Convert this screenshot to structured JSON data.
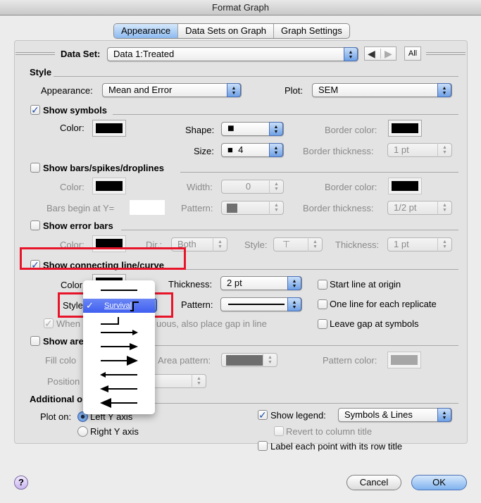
{
  "window": {
    "title": "Format Graph"
  },
  "tabs": [
    {
      "label": "Appearance",
      "active": true
    },
    {
      "label": "Data Sets on Graph",
      "active": false
    },
    {
      "label": "Graph Settings",
      "active": false
    }
  ],
  "dataset": {
    "label": "Data Set:",
    "value": "Data 1:Treated",
    "all_label": "All",
    "prev_icon": "arrow-left-icon",
    "next_icon": "arrow-right-icon"
  },
  "style": {
    "heading": "Style",
    "appearance_label": "Appearance:",
    "appearance_value": "Mean and Error",
    "plot_label": "Plot:",
    "plot_value": "SEM"
  },
  "symbols": {
    "heading": "Show symbols",
    "checked": true,
    "color_label": "Color:",
    "color": "#000000",
    "shape_label": "Shape:",
    "shape_value": "■",
    "size_label": "Size:",
    "size_value": "■  4",
    "border_color_label": "Border color:",
    "border_color": "#000000",
    "border_thickness_label": "Border thickness:",
    "border_thickness_value": "1 pt"
  },
  "bars": {
    "heading": "Show bars/spikes/droplines",
    "checked": false,
    "color_label": "Color:",
    "color": "#000000",
    "width_label": "Width:",
    "width_value": "0",
    "border_color_label": "Border color:",
    "border_color": "#000000",
    "begin_label": "Bars begin at Y=",
    "begin_value": "",
    "pattern_label": "Pattern:",
    "pattern_color": "#707070",
    "border_thickness_label": "Border thickness:",
    "border_thickness_value": "1/2 pt"
  },
  "error_bars": {
    "heading": "Show error bars",
    "checked": false,
    "color_label": "Color:",
    "color": "#000000",
    "dir_label": "Dir.:",
    "dir_value": "Both",
    "style_label": "Style:",
    "style_value": "⊤",
    "thickness_label": "Thickness:",
    "thickness_value": "1 pt"
  },
  "connecting_line": {
    "heading": "Show connecting line/curve",
    "checked": true,
    "color_label": "Color",
    "style_label": "Style",
    "thickness_label": "Thickness:",
    "thickness_value": "2 pt",
    "pattern_label": "Pattern:",
    "gap_label": "When ... discontinuous, also place gap in line",
    "gap_visible_text": "uous, also place gap in line",
    "when_text": "When",
    "gap_checked": true,
    "start_origin_label": "Start line at origin",
    "start_origin_checked": false,
    "one_line_label": "One line for each replicate",
    "one_line_checked": false,
    "leave_gap_label": "Leave gap at symbols",
    "leave_gap_checked": false
  },
  "style_menu": {
    "items": [
      {
        "name": "straight-line",
        "selected": false
      },
      {
        "name": "survival",
        "label": "Survival",
        "selected": true
      },
      {
        "name": "survival-down-step",
        "selected": false
      },
      {
        "name": "arrow-right-small",
        "selected": false
      },
      {
        "name": "arrow-right-medium",
        "selected": false
      },
      {
        "name": "arrow-right-large",
        "selected": false
      },
      {
        "name": "arrow-left-small",
        "selected": false
      },
      {
        "name": "arrow-left-medium",
        "selected": false
      },
      {
        "name": "arrow-left-large",
        "selected": false
      }
    ],
    "check_mark": "✓"
  },
  "area_fill": {
    "heading_visible": "Show are",
    "checked": false,
    "fill_color_label": "Fill colo",
    "area_pattern_label": "Area pattern:",
    "area_pattern_color": "#6e6e6e",
    "pattern_color_label": "Pattern color:",
    "pattern_color": "#a6a6a6",
    "position_label": "Position"
  },
  "additional": {
    "heading_visible": "Additional o",
    "plot_on_label": "Plot on:",
    "left_axis_label": "Left Y axis",
    "left_selected": true,
    "right_axis_label": "Right Y axis",
    "right_selected": false,
    "show_legend_label": "Show legend:",
    "show_legend_checked": true,
    "legend_value": "Symbols & Lines",
    "revert_label": "Revert to column title",
    "revert_checked": false,
    "label_points_label": "Label each point with its row title",
    "label_points_checked": false
  },
  "footer": {
    "help": "?",
    "cancel": "Cancel",
    "ok": "OK"
  },
  "colors": {
    "highlight_red": "#e8142a",
    "selection_blue": "#4a66f2",
    "default_button": "#7fb2ee"
  }
}
